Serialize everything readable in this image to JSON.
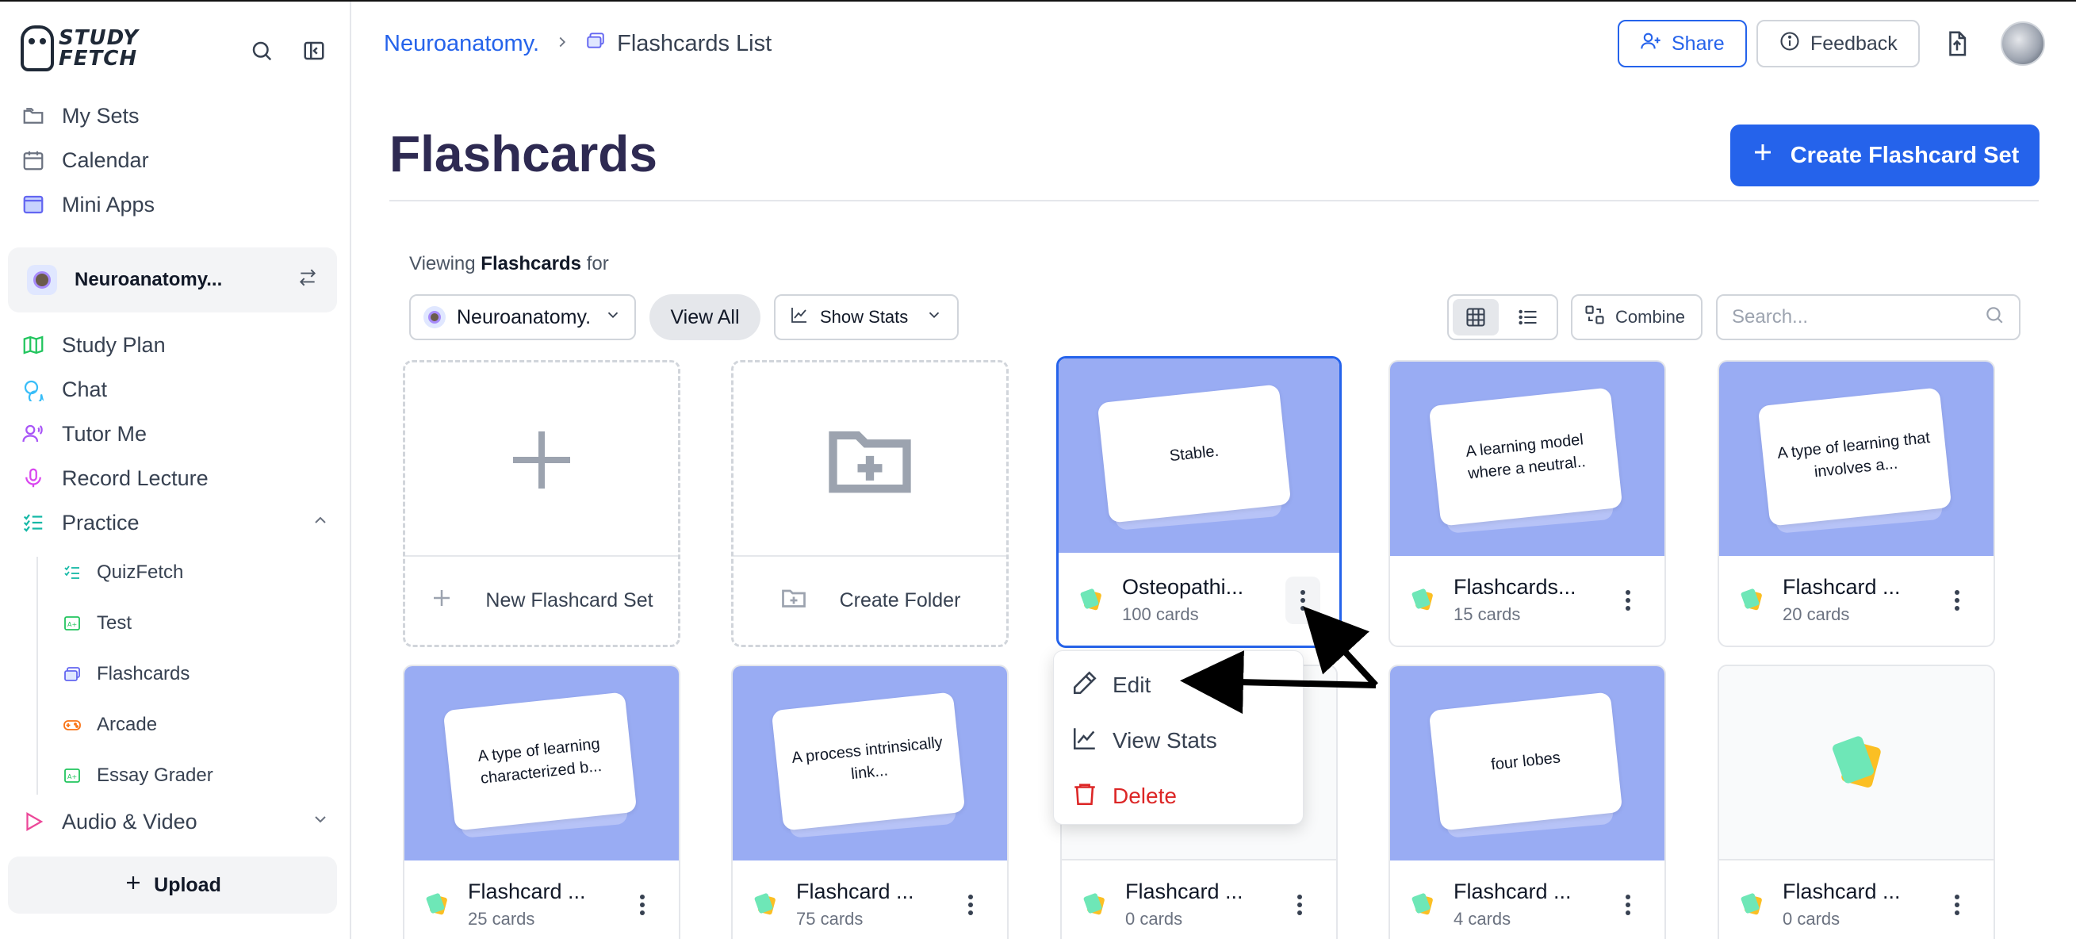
{
  "brand": {
    "name_line1": "STUDY",
    "name_line2": "FETCH"
  },
  "sidebar": {
    "nav": [
      {
        "label": "My Sets"
      },
      {
        "label": "Calendar"
      },
      {
        "label": "Mini Apps"
      }
    ],
    "course": {
      "name": "Neuroanatomy..."
    },
    "nav2": [
      {
        "label": "Study Plan"
      },
      {
        "label": "Chat"
      },
      {
        "label": "Tutor Me"
      },
      {
        "label": "Record Lecture"
      },
      {
        "label": "Practice"
      }
    ],
    "practice_items": [
      {
        "label": "QuizFetch"
      },
      {
        "label": "Test"
      },
      {
        "label": "Flashcards"
      },
      {
        "label": "Arcade"
      },
      {
        "label": "Essay Grader"
      }
    ],
    "audio_video": {
      "label": "Audio & Video"
    },
    "upload_label": "Upload"
  },
  "header": {
    "breadcrumb_course": "Neuroanatomy.",
    "breadcrumb_current": "Flashcards List",
    "share_label": "Share",
    "feedback_label": "Feedback"
  },
  "page": {
    "title": "Flashcards",
    "create_label": "Create Flashcard Set"
  },
  "toolbar": {
    "viewing_prefix": "Viewing",
    "viewing_bold": "Flashcards",
    "viewing_suffix": "for",
    "course_select": "Neuroanatomy.",
    "view_all": "View All",
    "show_stats": "Show Stats",
    "combine": "Combine",
    "search_placeholder": "Search..."
  },
  "actions": {
    "new_set": "New Flashcard Set",
    "create_folder": "Create Folder"
  },
  "cards": [
    {
      "preview": "Stable.",
      "title": "Osteopathi...",
      "count": "100 cards"
    },
    {
      "preview": "A learning model where a neutral..",
      "title": "Flashcards...",
      "count": "15 cards"
    },
    {
      "preview": "A type of learning that involves a...",
      "title": "Flashcard ...",
      "count": "20 cards"
    },
    {
      "preview": "A type of learning characterized b...",
      "title": "Flashcard ...",
      "count": "25 cards"
    },
    {
      "preview": "A process intrinsically link...",
      "title": "Flashcard ...",
      "count": "75 cards"
    },
    {
      "preview": "",
      "title": "Flashcard ...",
      "count": "0 cards"
    },
    {
      "preview": "four lobes",
      "title": "Flashcard ...",
      "count": "4 cards"
    },
    {
      "preview": "",
      "title": "Flashcard ...",
      "count": "0 cards"
    }
  ],
  "context_menu": {
    "edit": "Edit",
    "view_stats": "View Stats",
    "delete": "Delete"
  },
  "colors": {
    "accent": "#2563eb",
    "card_thumb": "#99acf3",
    "danger": "#dc2626"
  }
}
